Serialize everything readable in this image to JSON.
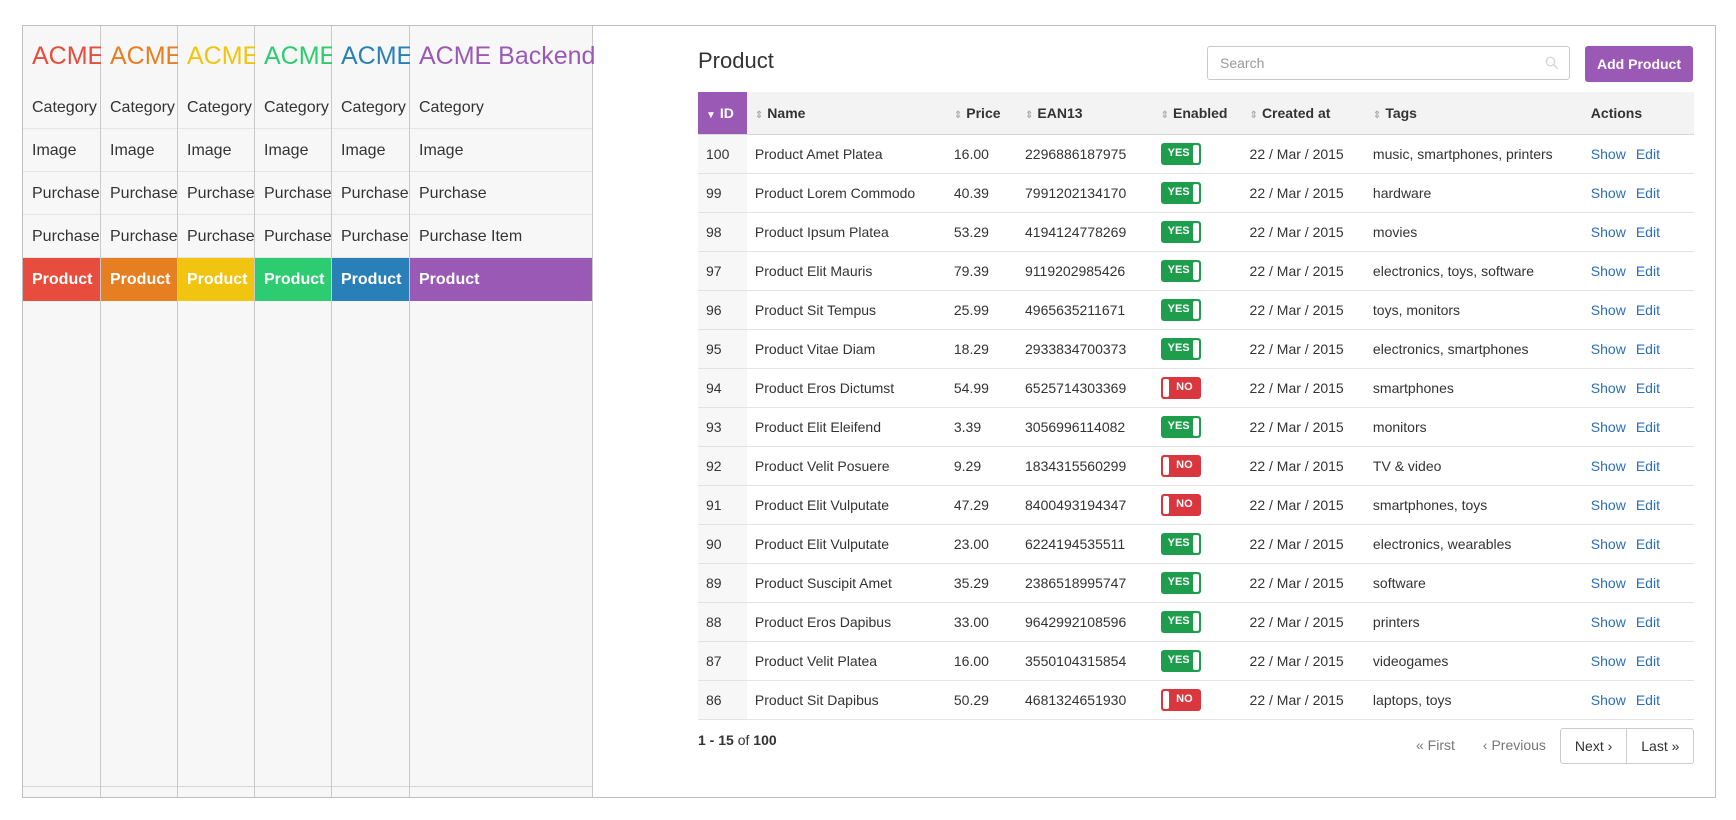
{
  "colors": {
    "red": "#e74c3c",
    "orange": "#e67e22",
    "yellow": "#f1c40f",
    "green": "#2ecc71",
    "blue": "#2980b9",
    "purple": "#9b59b6",
    "yes_badge": "#1e9e4c",
    "no_badge": "#d9363e",
    "link": "#2a6ebb"
  },
  "sidebars": [
    {
      "brand": "ACME",
      "items": [
        "Category",
        "Image",
        "Purchase",
        "Purchase",
        "Product"
      ]
    },
    {
      "brand": "ACME",
      "items": [
        "Category",
        "Image",
        "Purchase",
        "Purchase",
        "Product"
      ]
    },
    {
      "brand": "ACME",
      "items": [
        "Category",
        "Image",
        "Purchase",
        "Purchase",
        "Product"
      ]
    },
    {
      "brand": "ACME",
      "items": [
        "Category",
        "Image",
        "Purchase",
        "Purchase",
        "Product"
      ]
    },
    {
      "brand": "ACME",
      "items": [
        "Category",
        "Image",
        "Purchase",
        "Purchase",
        "Product"
      ]
    },
    {
      "brand": "ACME Backend",
      "items": [
        "Category",
        "Image",
        "Purchase",
        "Purchase Item",
        "Product"
      ]
    }
  ],
  "main": {
    "title": "Product",
    "search_placeholder": "Search",
    "add_button": "Add Product",
    "columns": [
      "ID",
      "Name",
      "Price",
      "EAN13",
      "Enabled",
      "Created at",
      "Tags",
      "Actions"
    ],
    "sorted_column": "ID",
    "rows": [
      {
        "id": "100",
        "name": "Product Amet Platea",
        "price": "16.00",
        "ean13": "2296886187975",
        "enabled": "YES",
        "created": "22 / Mar / 2015",
        "tags": "music, smartphones, printers"
      },
      {
        "id": "99",
        "name": "Product Lorem Commodo",
        "price": "40.39",
        "ean13": "7991202134170",
        "enabled": "YES",
        "created": "22 / Mar / 2015",
        "tags": "hardware"
      },
      {
        "id": "98",
        "name": "Product Ipsum Platea",
        "price": "53.29",
        "ean13": "4194124778269",
        "enabled": "YES",
        "created": "22 / Mar / 2015",
        "tags": "movies"
      },
      {
        "id": "97",
        "name": "Product Elit Mauris",
        "price": "79.39",
        "ean13": "9119202985426",
        "enabled": "YES",
        "created": "22 / Mar / 2015",
        "tags": "electronics, toys, software"
      },
      {
        "id": "96",
        "name": "Product Sit Tempus",
        "price": "25.99",
        "ean13": "4965635211671",
        "enabled": "YES",
        "created": "22 / Mar / 2015",
        "tags": "toys, monitors"
      },
      {
        "id": "95",
        "name": "Product Vitae Diam",
        "price": "18.29",
        "ean13": "2933834700373",
        "enabled": "YES",
        "created": "22 / Mar / 2015",
        "tags": "electronics, smartphones"
      },
      {
        "id": "94",
        "name": "Product Eros Dictumst",
        "price": "54.99",
        "ean13": "6525714303369",
        "enabled": "NO",
        "created": "22 / Mar / 2015",
        "tags": "smartphones"
      },
      {
        "id": "93",
        "name": "Product Elit Eleifend",
        "price": "3.39",
        "ean13": "3056996114082",
        "enabled": "YES",
        "created": "22 / Mar / 2015",
        "tags": "monitors"
      },
      {
        "id": "92",
        "name": "Product Velit Posuere",
        "price": "9.29",
        "ean13": "1834315560299",
        "enabled": "NO",
        "created": "22 / Mar / 2015",
        "tags": "TV & video"
      },
      {
        "id": "91",
        "name": "Product Elit Vulputate",
        "price": "47.29",
        "ean13": "8400493194347",
        "enabled": "NO",
        "created": "22 / Mar / 2015",
        "tags": "smartphones, toys"
      },
      {
        "id": "90",
        "name": "Product Elit Vulputate",
        "price": "23.00",
        "ean13": "6224194535511",
        "enabled": "YES",
        "created": "22 / Mar / 2015",
        "tags": "electronics, wearables"
      },
      {
        "id": "89",
        "name": "Product Suscipit Amet",
        "price": "35.29",
        "ean13": "2386518995747",
        "enabled": "YES",
        "created": "22 / Mar / 2015",
        "tags": "software"
      },
      {
        "id": "88",
        "name": "Product Eros Dapibus",
        "price": "33.00",
        "ean13": "9642992108596",
        "enabled": "YES",
        "created": "22 / Mar / 2015",
        "tags": "printers"
      },
      {
        "id": "87",
        "name": "Product Velit Platea",
        "price": "16.00",
        "ean13": "3550104315854",
        "enabled": "YES",
        "created": "22 / Mar / 2015",
        "tags": "videogames"
      },
      {
        "id": "86",
        "name": "Product Sit Dapibus",
        "price": "50.29",
        "ean13": "4681324651930",
        "enabled": "NO",
        "created": "22 / Mar / 2015",
        "tags": "laptops, toys"
      }
    ],
    "row_actions": [
      "Show",
      "Edit"
    ],
    "pagination": {
      "range": "1 - 15",
      "of_label": "of",
      "total": "100",
      "first": "« First",
      "previous": "‹ Previous",
      "next": "Next ›",
      "last": "Last »"
    }
  }
}
